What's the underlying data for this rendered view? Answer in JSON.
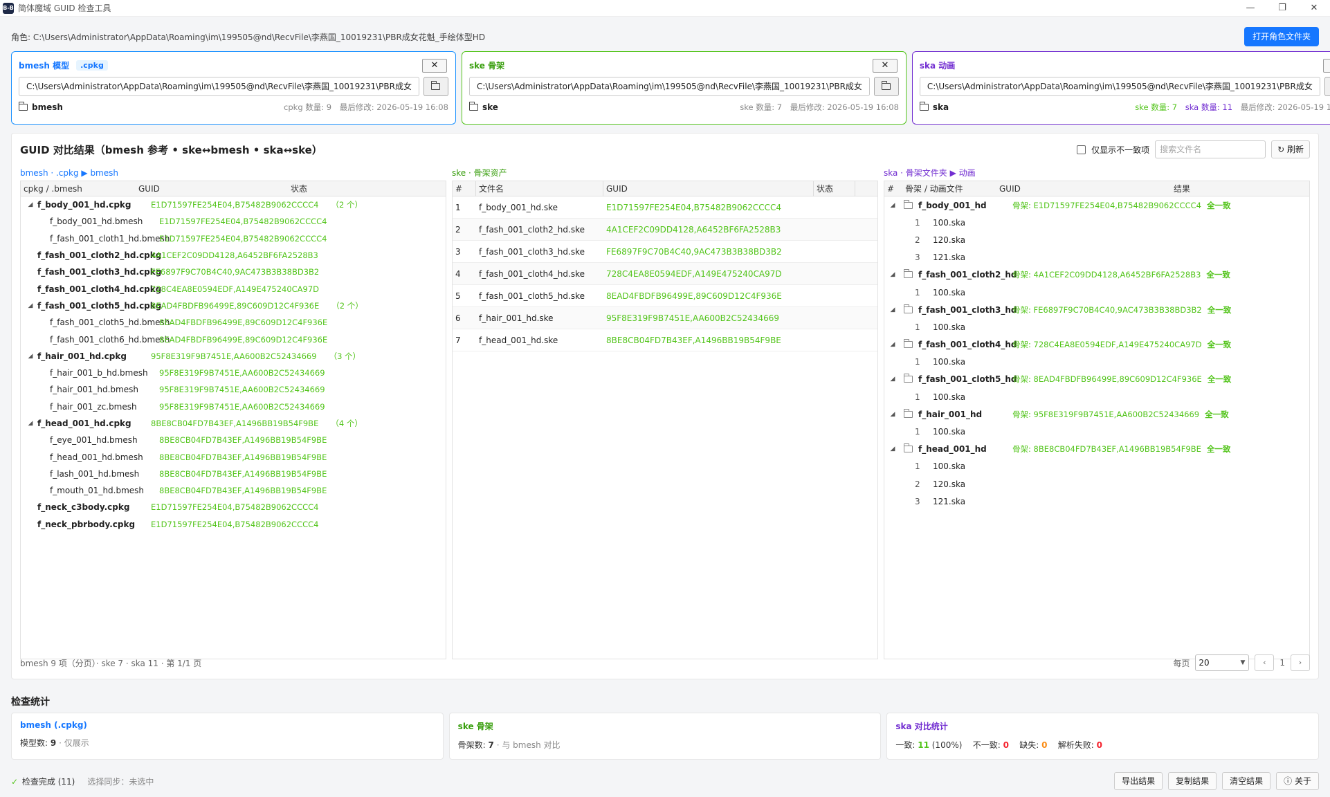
{
  "window": {
    "title": "简体魔域 GUID 检查工具",
    "icon_text": "B-B",
    "minimize": "—",
    "restore": "❐",
    "close": "✕"
  },
  "role": {
    "label": "角色: C:\\Users\\Administrator\\AppData\\Roaming\\im\\199505@nd\\RecvFile\\李燕国_10019231\\PBR成女花魁_手绘体型HD",
    "open_button": "打开角色文件夹"
  },
  "cards": {
    "bmesh": {
      "title": "bmesh 模型",
      "badge": ".cpkg",
      "path": "C:\\Users\\Administrator\\AppData\\Roaming\\im\\199505@nd\\RecvFile\\李燕国_10019231\\PBR成女",
      "folder": "bmesh",
      "stat1": "cpkg 数量: 9",
      "modified": "最后修改: 2026-05-19 16:08"
    },
    "ske": {
      "title": "ske 骨架",
      "path": "C:\\Users\\Administrator\\AppData\\Roaming\\im\\199505@nd\\RecvFile\\李燕国_10019231\\PBR成女",
      "folder": "ske",
      "stat1": "ske 数量: 7",
      "modified": "最后修改: 2026-05-19 16:08"
    },
    "ska": {
      "title": "ska 动画",
      "path": "C:\\Users\\Administrator\\AppData\\Roaming\\im\\199505@nd\\RecvFile\\李燕国_10019231\\PBR成女",
      "folder": "ska",
      "stat1": "ske 数量: 7",
      "stat2": "ska 数量: 11",
      "modified": "最后修改: 2026-05-19 16:08"
    },
    "close_label": "✕"
  },
  "result": {
    "title": "GUID 对比结果（bmesh 参考 • ske↔bmesh • ska↔ske）",
    "only_diff_label": "仅显示不一致项",
    "search_placeholder": "搜索文件名",
    "refresh_label": "↻ 刷新",
    "bmesh_col": {
      "label": "bmesh · .cpkg ▶ bmesh",
      "headers": [
        "cpkg / .bmesh",
        "GUID",
        "状态"
      ],
      "rows": [
        {
          "name": "f_body_001_hd.cpkg",
          "guid": "E1D71597FE254E04,B75482B9062CCCC4",
          "count": "（2 个）"
        },
        {
          "name": "f_body_001_hd.bmesh",
          "guid": "E1D71597FE254E04,B75482B9062CCCC4"
        },
        {
          "name": "f_fash_001_cloth1_hd.bmesh",
          "guid": "E1D71597FE254E04,B75482B9062CCCC4"
        },
        {
          "name": "f_fash_001_cloth2_hd.cpkg",
          "guid": "4A1CEF2C09DD4128,A6452BF6FA2528B3"
        },
        {
          "name": "f_fash_001_cloth3_hd.cpkg",
          "guid": "FE6897F9C70B4C40,9AC473B3B38BD3B2"
        },
        {
          "name": "f_fash_001_cloth4_hd.cpkg",
          "guid": "728C4EA8E0594EDF,A149E475240CA97D"
        },
        {
          "name": "f_fash_001_cloth5_hd.cpkg",
          "guid": "8EAD4FBDFB96499E,89C609D12C4F936E",
          "count": "（2 个）"
        },
        {
          "name": "f_fash_001_cloth5_hd.bmesh",
          "guid": "8EAD4FBDFB96499E,89C609D12C4F936E"
        },
        {
          "name": "f_fash_001_cloth6_hd.bmesh",
          "guid": "8EAD4FBDFB96499E,89C609D12C4F936E"
        },
        {
          "name": "f_hair_001_hd.cpkg",
          "guid": "95F8E319F9B7451E,AA600B2C52434669",
          "count": "（3 个）"
        },
        {
          "name": "f_hair_001_b_hd.bmesh",
          "guid": "95F8E319F9B7451E,AA600B2C52434669"
        },
        {
          "name": "f_hair_001_hd.bmesh",
          "guid": "95F8E319F9B7451E,AA600B2C52434669"
        },
        {
          "name": "f_hair_001_zc.bmesh",
          "guid": "95F8E319F9B7451E,AA600B2C52434669"
        },
        {
          "name": "f_head_001_hd.cpkg",
          "guid": "8BE8CB04FD7B43EF,A1496BB19B54F9BE",
          "count": "（4 个）"
        },
        {
          "name": "f_eye_001_hd.bmesh",
          "guid": "8BE8CB04FD7B43EF,A1496BB19B54F9BE"
        },
        {
          "name": "f_head_001_hd.bmesh",
          "guid": "8BE8CB04FD7B43EF,A1496BB19B54F9BE"
        },
        {
          "name": "f_lash_001_hd.bmesh",
          "guid": "8BE8CB04FD7B43EF,A1496BB19B54F9BE"
        },
        {
          "name": "f_mouth_01_hd.bmesh",
          "guid": "8BE8CB04FD7B43EF,A1496BB19B54F9BE"
        },
        {
          "name": "f_neck_c3body.cpkg",
          "guid": "E1D71597FE254E04,B75482B9062CCCC4"
        },
        {
          "name": "f_neck_pbrbody.cpkg",
          "guid": "E1D71597FE254E04,B75482B9062CCCC4"
        }
      ]
    },
    "ske_col": {
      "label": "ske · 骨架资产",
      "headers": [
        "#",
        "文件名",
        "GUID",
        "状态"
      ],
      "rows": [
        {
          "num": "1",
          "name": "f_body_001_hd.ske",
          "guid": "E1D71597FE254E04,B75482B9062CCCC4"
        },
        {
          "num": "2",
          "name": "f_fash_001_cloth2_hd.ske",
          "guid": "4A1CEF2C09DD4128,A6452BF6FA2528B3"
        },
        {
          "num": "3",
          "name": "f_fash_001_cloth3_hd.ske",
          "guid": "FE6897F9C70B4C40,9AC473B3B38BD3B2"
        },
        {
          "num": "4",
          "name": "f_fash_001_cloth4_hd.ske",
          "guid": "728C4EA8E0594EDF,A149E475240CA97D"
        },
        {
          "num": "5",
          "name": "f_fash_001_cloth5_hd.ske",
          "guid": "8EAD4FBDFB96499E,89C609D12C4F936E"
        },
        {
          "num": "6",
          "name": "f_hair_001_hd.ske",
          "guid": "95F8E319F9B7451E,AA600B2C52434669"
        },
        {
          "num": "7",
          "name": "f_head_001_hd.ske",
          "guid": "8BE8CB04FD7B43EF,A1496BB19B54F9BE"
        }
      ]
    },
    "ska_col": {
      "label": "ska · 骨架文件夹 ▶ 动画",
      "headers": [
        "#",
        "骨架 / 动画文件",
        "GUID",
        "结果"
      ],
      "rows": [
        {
          "name": "f_body_001_hd",
          "guid": "骨架: E1D71597FE254E04,B75482B9062CCCC4",
          "result": "全一致"
        },
        {
          "num": "1",
          "name": "100.ska"
        },
        {
          "num": "2",
          "name": "120.ska"
        },
        {
          "num": "3",
          "name": "121.ska"
        },
        {
          "name": "f_fash_001_cloth2_hd",
          "guid": "骨架: 4A1CEF2C09DD4128,A6452BF6FA2528B3",
          "result": "全一致"
        },
        {
          "num": "1",
          "name": "100.ska"
        },
        {
          "name": "f_fash_001_cloth3_hd",
          "guid": "骨架: FE6897F9C70B4C40,9AC473B3B38BD3B2",
          "result": "全一致"
        },
        {
          "num": "1",
          "name": "100.ska"
        },
        {
          "name": "f_fash_001_cloth4_hd",
          "guid": "骨架: 728C4EA8E0594EDF,A149E475240CA97D",
          "result": "全一致"
        },
        {
          "num": "1",
          "name": "100.ska"
        },
        {
          "name": "f_fash_001_cloth5_hd",
          "guid": "骨架: 8EAD4FBDFB96499E,89C609D12C4F936E",
          "result": "全一致"
        },
        {
          "num": "1",
          "name": "100.ska"
        },
        {
          "name": "f_hair_001_hd",
          "guid": "骨架: 95F8E319F9B7451E,AA600B2C52434669",
          "result": "全一致"
        },
        {
          "num": "1",
          "name": "100.ska"
        },
        {
          "name": "f_head_001_hd",
          "guid": "骨架: 8BE8CB04FD7B43EF,A1496BB19B54F9BE",
          "result": "全一致"
        },
        {
          "num": "1",
          "name": "100.ska"
        },
        {
          "num": "2",
          "name": "120.ska"
        },
        {
          "num": "3",
          "name": "121.ska"
        }
      ]
    },
    "footer_summary": "bmesh 9 项（分页）· ske 7 · ska 11 · 第 1/1 页",
    "per_page_label": "每页",
    "per_page_value": "20",
    "prev": "‹",
    "next": "›",
    "page": "1"
  },
  "stats": {
    "title": "检查统计",
    "bmesh": {
      "title": "bmesh (.cpkg)",
      "label": "模型数:",
      "value": "9",
      "note": "· 仅展示"
    },
    "ske": {
      "title": "ske 骨架",
      "label": "骨架数:",
      "value": "7",
      "note": "· 与 bmesh 对比"
    },
    "ska": {
      "title": "ska 对比统计",
      "consistent_label": "一致:",
      "consistent": "11",
      "percent": "(100%)",
      "mismatch_label": "不一致:",
      "mismatch": "0",
      "missing_label": "缺失:",
      "missing": "0",
      "parse_fail_label": "解析失败:",
      "parse_fail": "0"
    }
  },
  "statusbar": {
    "done": "检查完成",
    "done_count": "(11)",
    "sync": "选择同步：未选中",
    "export": "导出结果",
    "copy": "复制结果",
    "clear": "清空结果",
    "about": "关于"
  }
}
